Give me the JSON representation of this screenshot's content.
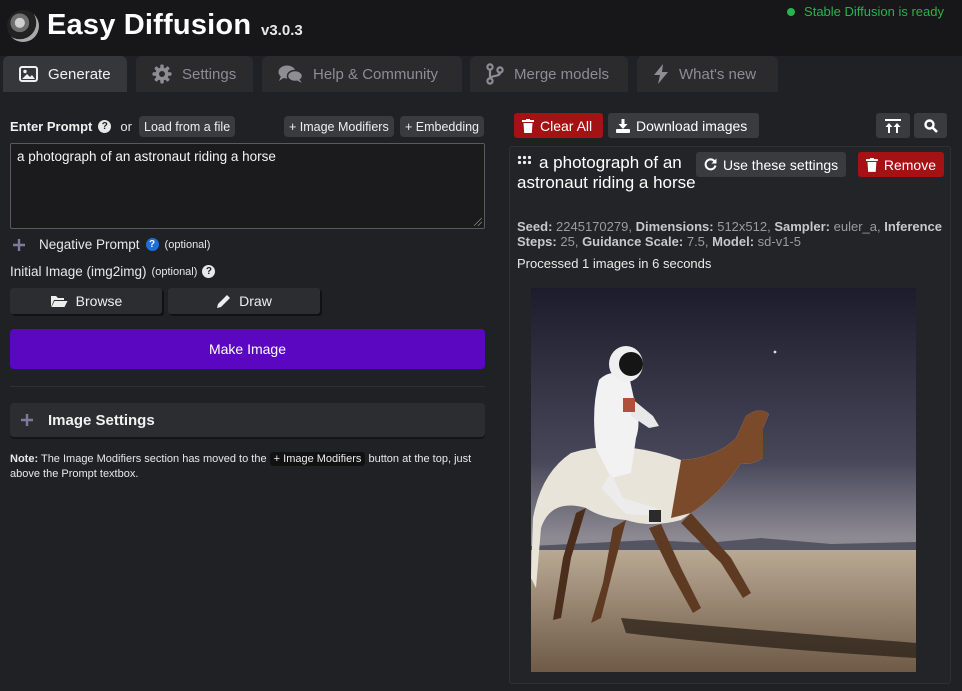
{
  "header": {
    "title": "Easy Diffusion",
    "version": "v3.0.3",
    "status": "Stable Diffusion is ready",
    "status_color": "#29b34a"
  },
  "tabs": [
    {
      "label": "Generate",
      "icon": "image-icon",
      "active": true
    },
    {
      "label": "Settings",
      "icon": "gear-icon",
      "active": false
    },
    {
      "label": "Help & Community",
      "icon": "comments-icon",
      "active": false
    },
    {
      "label": "Merge models",
      "icon": "code-branch-icon",
      "active": false
    },
    {
      "label": "What's new",
      "icon": "bolt-icon",
      "active": false
    }
  ],
  "prompt": {
    "label": "Enter Prompt",
    "or_text": "or",
    "load_file_label": "Load from a file",
    "image_modifiers_label": "+ Image Modifiers",
    "embedding_label": "+ Embedding",
    "value": "a photograph of an astronaut riding a horse"
  },
  "negative_prompt": {
    "label": "Negative Prompt",
    "optional": "(optional)"
  },
  "init_image": {
    "label": "Initial Image (img2img)",
    "optional": "(optional)",
    "browse_label": "Browse",
    "draw_label": "Draw"
  },
  "make_image_label": "Make Image",
  "make_image_color": "#5b07c2",
  "image_settings_label": "Image Settings",
  "note": {
    "prefix": "Note:",
    "text1": "The Image Modifiers section has moved to the",
    "chip": "+ Image Modifiers",
    "text2": "button at the top, just above the Prompt textbox."
  },
  "toolbar": {
    "clear_all_label": "Clear All",
    "download_label": "Download images",
    "clear_color": "#a41214"
  },
  "task": {
    "title": "a photograph of an astronaut riding a horse",
    "use_settings_label": "Use these settings",
    "remove_label": "Remove",
    "seed_label": "Seed:",
    "seed": "2245170279,",
    "dimensions_label": "Dimensions:",
    "dimensions": "512x512,",
    "sampler_label": "Sampler:",
    "sampler": "euler_a,",
    "steps_label": "Inference Steps:",
    "steps": "25,",
    "guidance_label": "Guidance Scale:",
    "guidance": "7.5,",
    "model_label": "Model:",
    "model": "sd-v1-5",
    "progress": "Processed 1 images in 6 seconds"
  }
}
